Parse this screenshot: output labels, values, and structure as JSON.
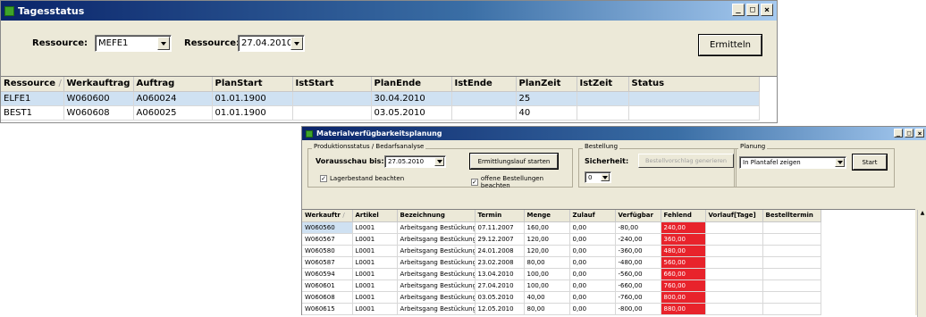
{
  "main": {
    "title": "Tagesstatus",
    "controls": {
      "minimize": "_",
      "maximize": "□",
      "close": "×"
    },
    "label_ressource_1": "Ressource:",
    "combo_ressource_value": "MEFE1",
    "label_ressource_2": "Ressource:",
    "combo_date_value": "27.04.2010",
    "ermitteln_label": "Ermitteln",
    "columns": [
      "Ressource",
      "Werkauftrag",
      "Auftrag",
      "PlanStart",
      "IstStart",
      "PlanEnde",
      "IstEnde",
      "PlanZeit",
      "IstZeit",
      "Status"
    ],
    "sort_glyph": "/",
    "rows": [
      [
        "ELFE1",
        "W060600",
        "A060024",
        "01.01.1900",
        "",
        "30.04.2010",
        "",
        "25",
        "",
        ""
      ],
      [
        "BEST1",
        "W060608",
        "A060025",
        "01.01.1900",
        "",
        "03.05.2010",
        "",
        "40",
        "",
        ""
      ]
    ]
  },
  "mvp": {
    "title": "Materialverfügbarkeitsplanung",
    "controls": {
      "minimize": "_",
      "maximize": "□",
      "close": "×"
    },
    "group_produktion": "Produktionsstatus / Bedarfsanalyse",
    "vorausschau_label": "Vorausschau bis:",
    "vorausschau_value": "27.05.2010",
    "ermittlungslauf_label": "Ermittlungslauf starten",
    "chk_lagerbestand": "Lagerbestand beachten",
    "chk_offene": "offene Bestellungen beachten",
    "check_mark": "✓",
    "group_bestellung": "Bestellung",
    "sicherheit_label": "Sicherheit:",
    "sicherheit_value": "0",
    "bestellvorschlag_label": "Bestellvorschlag generieren",
    "group_planung": "Planung",
    "planung_value": "In Plantafel zeigen",
    "start_label": "Start",
    "columns": [
      "Werkauftr",
      "Artikel",
      "Bezeichnung",
      "Termin",
      "Menge",
      "Zulauf",
      "Verfügbar",
      "Fehlend",
      "Vorlauf[Tage]",
      "Bestelltermin"
    ],
    "sort_glyph": "/",
    "rows": [
      [
        "W060560",
        "L0001",
        "Arbeitsgang Bestückung",
        "07.11.2007",
        "160,00",
        "0,00",
        "-80,00",
        "240,00",
        "",
        ""
      ],
      [
        "W060567",
        "L0001",
        "Arbeitsgang Bestückung",
        "29.12.2007",
        "120,00",
        "0,00",
        "-240,00",
        "360,00",
        "",
        ""
      ],
      [
        "W060580",
        "L0001",
        "Arbeitsgang Bestückung",
        "24.01.2008",
        "120,00",
        "0,00",
        "-360,00",
        "480,00",
        "",
        ""
      ],
      [
        "W060587",
        "L0001",
        "Arbeitsgang Bestückung",
        "23.02.2008",
        "80,00",
        "0,00",
        "-480,00",
        "560,00",
        "",
        ""
      ],
      [
        "W060594",
        "L0001",
        "Arbeitsgang Bestückung",
        "13.04.2010",
        "100,00",
        "0,00",
        "-560,00",
        "660,00",
        "",
        ""
      ],
      [
        "W060601",
        "L0001",
        "Arbeitsgang Bestückung",
        "27.04.2010",
        "100,00",
        "0,00",
        "-660,00",
        "760,00",
        "",
        ""
      ],
      [
        "W060608",
        "L0001",
        "Arbeitsgang Bestückung",
        "03.05.2010",
        "40,00",
        "0,00",
        "-760,00",
        "800,00",
        "",
        ""
      ],
      [
        "W060615",
        "L0001",
        "Arbeitsgang Bestückung",
        "12.05.2010",
        "80,00",
        "0,00",
        "-800,00",
        "880,00",
        "",
        ""
      ]
    ],
    "accent_missing": "#e8232b",
    "scroll_up": "▲"
  }
}
